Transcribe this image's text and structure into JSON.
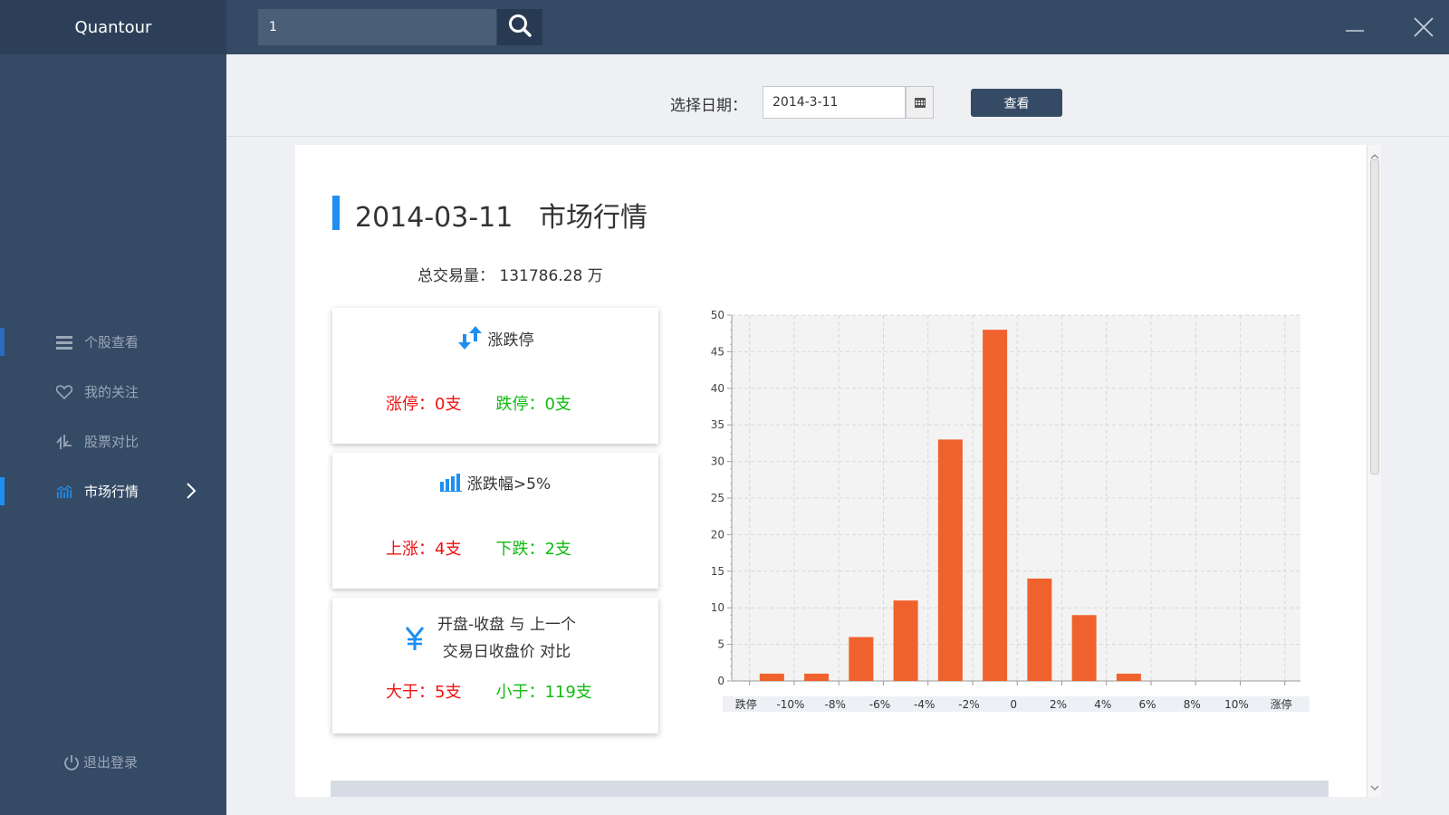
{
  "app": {
    "brand": "Quantour"
  },
  "search": {
    "value": "1"
  },
  "sidebar": {
    "items": [
      {
        "label": "个股查看",
        "icon": "list-icon"
      },
      {
        "label": "我的关注",
        "icon": "heart-icon"
      },
      {
        "label": "股票对比",
        "icon": "compare-icon"
      },
      {
        "label": "市场行情",
        "icon": "market-chart-icon"
      }
    ],
    "active_index": 3,
    "logout_label": "退出登录"
  },
  "datebar": {
    "label": "选择日期：",
    "date_value": "2014-3-11",
    "view_button": "查看"
  },
  "report": {
    "title": "2014-03-11   市场行情",
    "total_volume_label": "总交易量：",
    "total_volume_value": "131786.28 万"
  },
  "cards": {
    "limit": {
      "title": "涨跌停",
      "up": "涨停：0支",
      "down": "跌停：0支"
    },
    "over5": {
      "title": "涨跌幅>5%",
      "up": "上涨：4支",
      "down": "下跌：2支"
    },
    "compare": {
      "title_line1": "开盘-收盘 与 上一个",
      "title_line2": "交易日收盘价 对比",
      "up": "大于：5支",
      "down": "小于：119支"
    }
  },
  "colors": {
    "accent": "#1e8ff0",
    "bar": "#f0622d",
    "sidebar": "#354a65",
    "up": "#ee1111",
    "down": "#11bb11"
  },
  "chart_data": {
    "type": "bar",
    "categories": [
      "跌停",
      "-10%",
      "-8%",
      "-6%",
      "-4%",
      "-2%",
      "0",
      "2%",
      "4%",
      "6%",
      "8%",
      "10%",
      "涨停"
    ],
    "values": [
      1,
      1,
      6,
      11,
      33,
      48,
      14,
      9,
      1,
      0,
      0,
      0
    ],
    "ylim": [
      0,
      50
    ],
    "yticks": [
      0,
      5,
      10,
      15,
      20,
      25,
      30,
      35,
      40,
      45,
      50
    ],
    "grid": true
  }
}
